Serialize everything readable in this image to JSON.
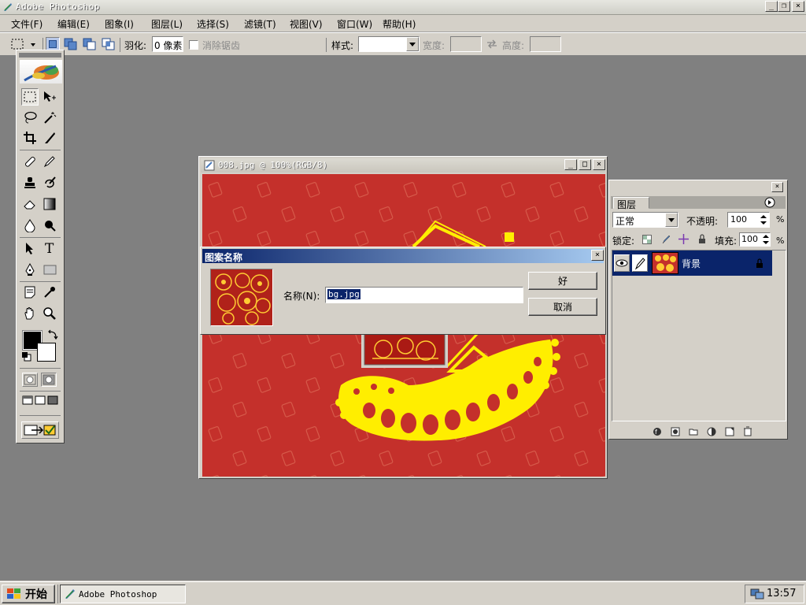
{
  "app": {
    "title": "Adobe Photoshop"
  },
  "menu": [
    "文件(F)",
    "编辑(E)",
    "图象(I)",
    "图层(L)",
    "选择(S)",
    "滤镜(T)",
    "视图(V)",
    "窗口(W)",
    "帮助(H)"
  ],
  "options": {
    "feather_label": "羽化:",
    "feather_value": "0 像素",
    "antialias_label": "消除锯齿",
    "style_label": "样式:",
    "style_value": "",
    "width_label": "宽度:",
    "height_label": "高度:"
  },
  "document": {
    "title": "008.jpg @ 100%(RGB/8)"
  },
  "dialog": {
    "title": "图案名称",
    "name_label": "名称(N):",
    "name_value": "bg.jpg",
    "ok_label": "好",
    "cancel_label": "取消"
  },
  "layers": {
    "tab_label": "图层",
    "blend_mode": "正常",
    "opacity_label": "不透明:",
    "opacity_value": "100",
    "lock_label": "锁定:",
    "fill_label": "填充:",
    "fill_value": "100",
    "percent": "%",
    "layer_name": "背景"
  },
  "taskbar": {
    "start_label": "开始",
    "task_label": "Adobe Photoshop",
    "clock": "13:57"
  },
  "colors": {
    "dialog_title": "#0a246a",
    "canvas_red": "#c4302b",
    "motif_yellow": "#ffee00",
    "selection": "#0a246a"
  }
}
